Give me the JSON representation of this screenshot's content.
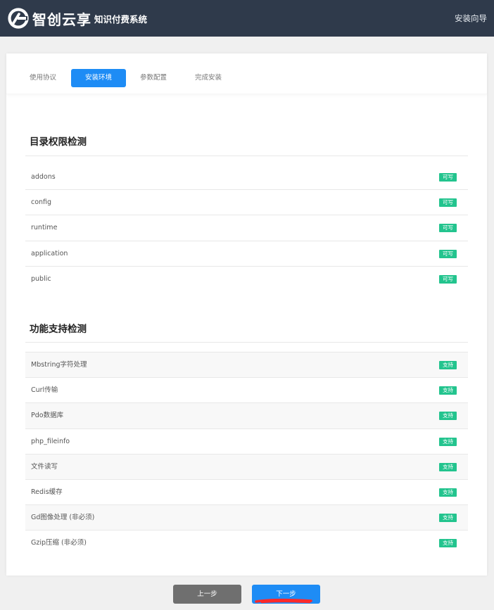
{
  "header": {
    "brand": "智创云享",
    "subtitle": "知识付费系统",
    "right_link": "安装向导"
  },
  "tabs": [
    {
      "label": "使用协议",
      "active": false
    },
    {
      "label": "安装环境",
      "active": true
    },
    {
      "label": "参数配置",
      "active": false
    },
    {
      "label": "完成安装",
      "active": false
    }
  ],
  "dir_section": {
    "title": "目录权限检测",
    "rows": [
      {
        "name": "addons",
        "status": "可写"
      },
      {
        "name": "config",
        "status": "可写"
      },
      {
        "name": "runtime",
        "status": "可写"
      },
      {
        "name": "application",
        "status": "可写"
      },
      {
        "name": "public",
        "status": "可写"
      }
    ]
  },
  "func_section": {
    "title": "功能支持检测",
    "rows": [
      {
        "name": "Mbstring字符处理",
        "status": "支持"
      },
      {
        "name": "Curl传输",
        "status": "支持"
      },
      {
        "name": "Pdo数据库",
        "status": "支持"
      },
      {
        "name": "php_fileinfo",
        "status": "支持"
      },
      {
        "name": "文件读写",
        "status": "支持"
      },
      {
        "name": "Redis缓存",
        "status": "支持"
      },
      {
        "name": "Gd图像处理 (非必须)",
        "status": "支持"
      },
      {
        "name": "Gzip压缩 (非必须)",
        "status": "支持"
      }
    ]
  },
  "buttons": {
    "prev": "上一步",
    "next": "下一步"
  },
  "colors": {
    "header_bg": "#2f3a4b",
    "accent": "#1e8cf5",
    "badge": "#23c48e",
    "annotation": "#ff2a2a"
  },
  "icons": {
    "logo": "brand-g-logo-icon"
  }
}
